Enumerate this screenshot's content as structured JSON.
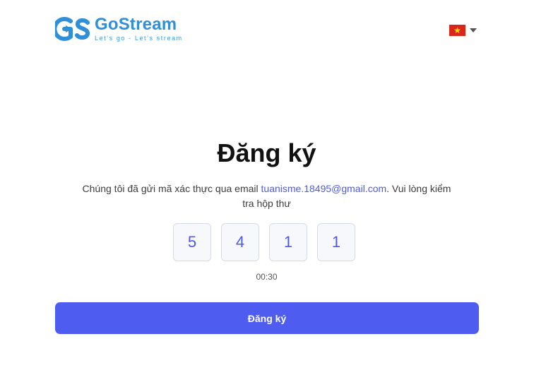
{
  "header": {
    "logo": {
      "name": "GoStream",
      "tagline": "Let's go - Let's stream",
      "icon": "gostream-logo-icon",
      "brand_color": "#2f8fd8"
    },
    "language": {
      "icon": "vietnam-flag-icon",
      "caret_icon": "caret-down-icon"
    }
  },
  "main": {
    "title": "Đăng ký",
    "description": {
      "prefix": "Chúng tôi đã gửi mã xác thực qua email ",
      "email": "tuanisme.18495@gmail.com",
      "suffix": ". Vui lòng kiểm tra hộp thư"
    },
    "otp_digits": [
      "5",
      "4",
      "1",
      "1"
    ],
    "timer": "00:30",
    "submit_label": "Đăng ký",
    "accent_color": "#4f5cf0"
  }
}
